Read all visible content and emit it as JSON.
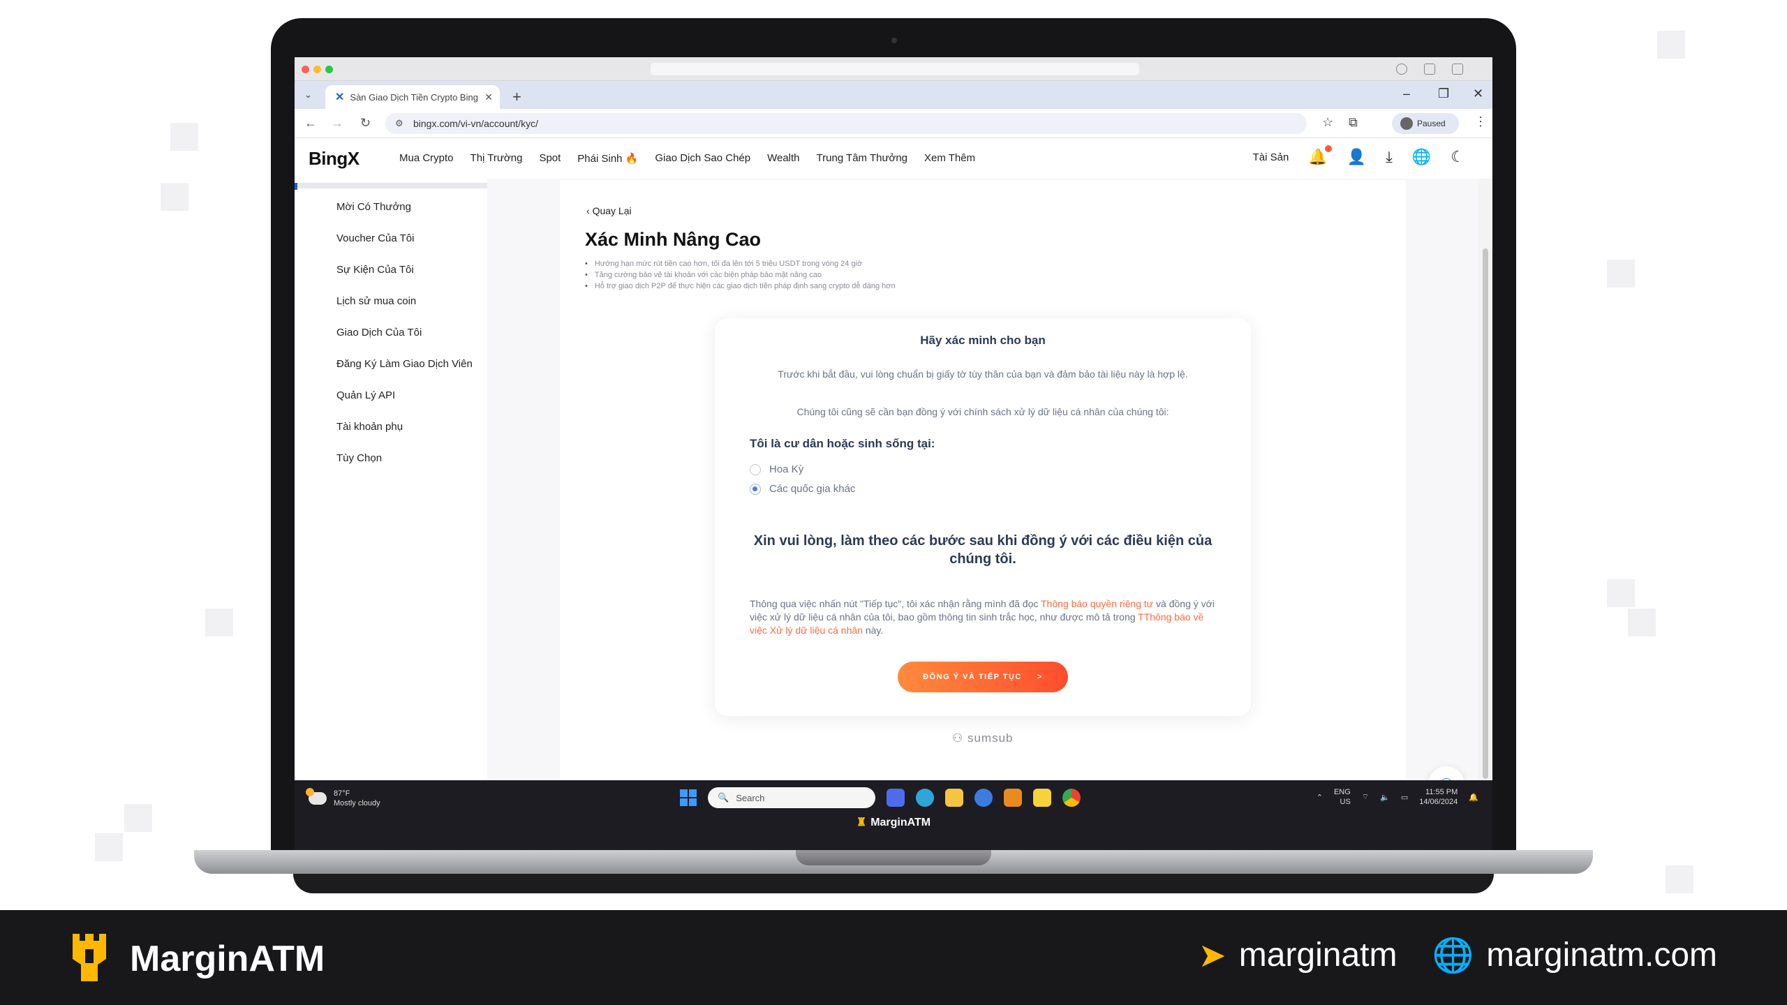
{
  "browser": {
    "tab_title": "Sàn Giao Dịch Tiền Crypto Bing",
    "url": "bingx.com/vi-vn/account/kyc/",
    "profile_status": "Paused"
  },
  "site": {
    "logo": "BingX",
    "nav": [
      "Mua Crypto",
      "Thị Trường",
      "Spot",
      "Phái Sinh 🔥",
      "Giao Dịch Sao Chép",
      "Wealth",
      "Trung Tâm Thưởng",
      "Xem Thêm"
    ],
    "assets_label": "Tài Sản"
  },
  "sidebar": {
    "items": [
      "Mời Có Thưởng",
      "Voucher Của Tôi",
      "Sự Kiện Của Tôi",
      "Lịch sử mua coin",
      "Giao Dịch Của Tôi",
      "Đăng Ký Làm Giao Dịch Viên",
      "Quản Lý API",
      "Tài khoản phụ",
      "Tùy Chọn"
    ]
  },
  "page": {
    "back_label": "Quay Lại",
    "title": "Xác Minh Nâng Cao",
    "bullets": [
      "Hướng hạn mức rút tiền cao hơn, tối đa lên tới 5 triệu USDT trong vòng 24 giờ",
      "Tăng cường bảo vệ tài khoản với các biện pháp bảo mật nâng cao",
      "Hỗ trợ giao dịch P2P để thực hiện các giao dịch tiền pháp định sang crypto dễ dàng hơn"
    ]
  },
  "card": {
    "title": "Hãy xác minh cho bạn",
    "intro": "Trước khi bắt đầu, vui lòng chuẩn bị giấy tờ tùy thân của bạn và đảm bảo tài liệu này là hợp lệ.",
    "consent_note": "Chúng tôi cũng sẽ cần bạn đồng ý với chính sách xử lý dữ liệu cá nhân của chúng tôi:",
    "question": "Tôi là cư dân hoặc sinh sống tại:",
    "options": [
      "Hoa Kỳ",
      "Các quốc gia khác"
    ],
    "selected_option": "Các quốc gia khác",
    "heading": "Xin vui lòng, làm theo các bước sau khi đồng ý với các điều kiện của chúng tôi.",
    "legal_1": "Thông qua việc nhấn nút \"Tiếp tục\", tôi xác nhận rằng mình đã đọc ",
    "legal_link_1": "Thông báo quyền riêng tư",
    "legal_2": " và đồng ý với việc xử lý dữ liệu cá nhân của tôi, bao gồm thông tin sinh trắc học, như được mô tả trong ",
    "legal_link_2": "TThông báo về việc Xử lý dữ liệu cá nhân",
    "legal_3": " này.",
    "cta_label": "ĐỒNG Ý VÀ TIẾP TỤC",
    "cta_arrow": ">",
    "provider": "sumsub"
  },
  "taskbar": {
    "temp": "87°F",
    "weather": "Mostly cloudy",
    "search_placeholder": "Search",
    "lang": "ENG",
    "region": "US",
    "time": "11:55 PM",
    "date": "14/06/2024",
    "watermark": "MarginATM"
  },
  "footer": {
    "brand": "MarginATM",
    "telegram": "marginatm",
    "website": "marginatm.com"
  },
  "colors": {
    "accent_blue": "#1f5fe0",
    "cta_orange": "#ff6a3d",
    "brand_yellow": "#ffb800"
  }
}
